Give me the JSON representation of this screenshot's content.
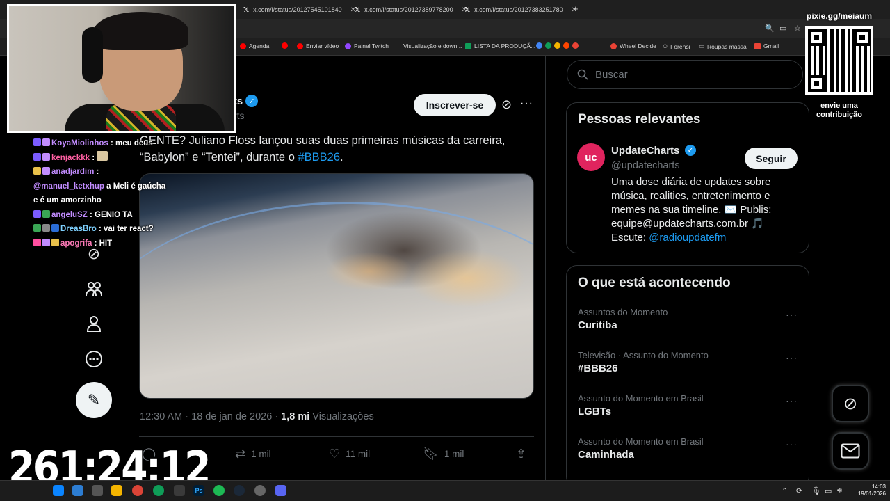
{
  "browser": {
    "tabs": [
      {
        "label": "x.com/i/status/20127545101840"
      },
      {
        "label": "x.com/i/status/20127389778200"
      },
      {
        "label": "x.com/i/status/20127383251780"
      }
    ],
    "new_tab": "+",
    "bookmarks": [
      {
        "label": "Agenda",
        "color": "#ff0000"
      },
      {
        "label": "",
        "color": "#ff0000"
      },
      {
        "label": "Enviar vídeo",
        "color": "#ff0000"
      },
      {
        "label": "Painel Twitch",
        "color": "#9146ff"
      },
      {
        "label": "Visualização e down...",
        "color": "#444444"
      },
      {
        "label": "LISTA DA PRODUÇÃ...",
        "color": "#0f9d58"
      },
      {
        "label": "Wheel Decide",
        "color": "#ea4335"
      },
      {
        "label": "Forensi",
        "color": "#888888"
      },
      {
        "label": "Roupas massa",
        "color": "#aaaaaa"
      },
      {
        "label": "Gmail",
        "color": "#ea4335"
      }
    ]
  },
  "chat": [
    {
      "user": "KoyaMiolinhos",
      "user_color": "#c28cff",
      "message": "meu deus"
    },
    {
      "user": "kenjackkk",
      "user_color": "#ff5fa2",
      "message": ""
    },
    {
      "user": "anadjardim",
      "user_color": "#c28cff",
      "message": ""
    },
    {
      "user": "@manuel_ketxhup",
      "user_color": "#c28cff",
      "message": "a Meli é gaúcha e é um amorzinho"
    },
    {
      "user": "angeluSZ",
      "user_color": "#c28cff",
      "message": "GENIO TA"
    },
    {
      "user": "DreasBro",
      "user_color": "#7fd1ff",
      "message": "vai ter react?"
    },
    {
      "user": "apogrifa",
      "user_color": "#ff7ab8",
      "message": "HIT"
    }
  ],
  "tweet": {
    "author_name": "rts",
    "author_handle": "rts",
    "subscribe_label": "Inscrever-se",
    "text_before": "GENTE? Juliano Floss lançou suas duas primeiras músicas da carreira, “Babylon” e “Tentei”, durante o ",
    "hashtag": "#BBB26",
    "text_after": ".",
    "timestamp": "12:30 AM · 18 de jan de 2026 · ",
    "views_count": "1,8 mi",
    "views_label": " Visualizações",
    "actions": {
      "retweets": "1 mil",
      "likes": "11 mil",
      "bookmarks": "1 mil"
    }
  },
  "sidebar": {
    "search_placeholder": "Buscar",
    "relevant_title": "Pessoas relevantes",
    "relevant_person": {
      "avatar": "uc",
      "name": "UpdateCharts",
      "handle": "@updatecharts",
      "follow_label": "Seguir",
      "bio": "Uma dose diária de updates sobre música, realities, entretenimento e memes na sua timeline. ✉️ Publis: equipe@updatecharts.com.br 🎵 Escute: ",
      "bio_link": "@radioupdatefm"
    },
    "trends_title": "O que está acontecendo",
    "trends": [
      {
        "meta": "Assuntos do Momento",
        "name": "Curitiba"
      },
      {
        "meta": "Televisão · Assunto do Momento",
        "name": "#BBB26"
      },
      {
        "meta": "Assunto do Momento em Brasil",
        "name": "LGBTs"
      },
      {
        "meta": "Assunto do Momento em Brasil",
        "name": "Caminhada"
      }
    ]
  },
  "overlay": {
    "qr_url": "pixie.gg/meiaum",
    "qr_caption_line1": "envie uma",
    "qr_caption_line2": "contribuição",
    "timer": "261:24:12"
  },
  "taskbar": {
    "time": "14:03",
    "date": "19/01/2026"
  },
  "colors": {
    "background": "#000000",
    "accent": "#1d9bf0",
    "text_primary": "#e7e9ea",
    "text_secondary": "#71767b",
    "border": "#2f3336"
  }
}
